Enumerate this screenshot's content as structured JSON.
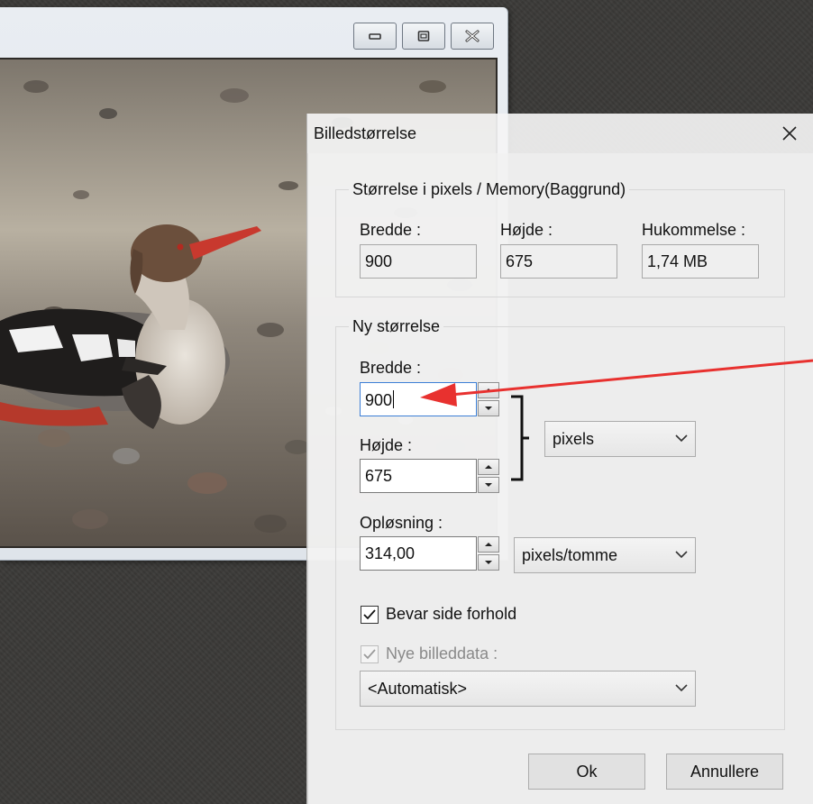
{
  "dialog": {
    "title": "Billedstørrelse",
    "pixel_group": {
      "legend": "Størrelse i pixels / Memory(Baggrund)",
      "width_label": "Bredde :",
      "width_value": "900",
      "height_label": "Højde :",
      "height_value": "675",
      "memory_label": "Hukommelse :",
      "memory_value": "1,74 MB"
    },
    "new_size_group": {
      "legend": "Ny størrelse",
      "width_label": "Bredde :",
      "width_value": "900",
      "height_label": "Højde :",
      "height_value": "675",
      "unit_selected": "pixels",
      "resolution_label": "Opløsning :",
      "resolution_value": "314,00",
      "resolution_unit_selected": "pixels/tomme",
      "keep_ratio_label": "Bevar side forhold",
      "keep_ratio_checked": true,
      "new_data_label": "Nye billeddata :",
      "new_data_checked": true,
      "resample_selected": "<Automatisk>"
    },
    "ok_label": "Ok",
    "cancel_label": "Annullere"
  },
  "icons": {
    "close": "close-icon",
    "minimize": "minimize-icon",
    "restore": "restore-icon",
    "window_close": "window-close-icon",
    "spin_up": "spin-up-icon",
    "spin_down": "spin-down-icon",
    "chevron": "chevron-down-icon",
    "check": "checkmark-icon",
    "link_bracket": "link-bracket-icon",
    "annotation_arrow": "red-arrow-icon"
  },
  "colors": {
    "annotation": "#e8312f",
    "focus_border": "#3c7fd6"
  }
}
